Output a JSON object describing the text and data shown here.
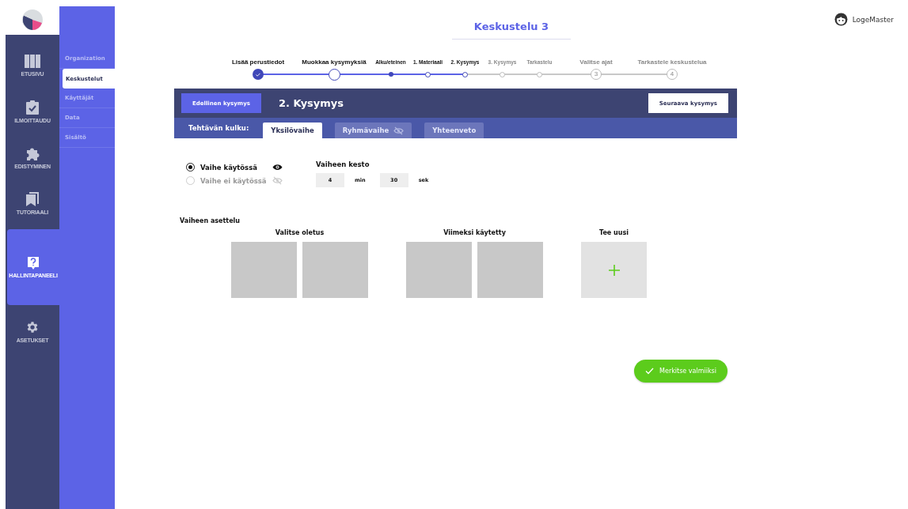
{
  "rail": {
    "items": [
      {
        "label": "ETUSIVU",
        "selected": false
      },
      {
        "label": "ILMOITTAUDU",
        "selected": false
      },
      {
        "label": "EDISTYMINEN",
        "selected": false
      },
      {
        "label": "TUTORIAALI",
        "selected": false
      },
      {
        "label": "HALLINTAPANEELI",
        "selected": true
      },
      {
        "label": "ASETUKSET",
        "selected": false
      }
    ]
  },
  "sidebar": {
    "items": [
      {
        "label": "Organization",
        "selected": false
      },
      {
        "label": "Keskustelut",
        "selected": true
      },
      {
        "label": "Käyttäjät",
        "selected": false
      },
      {
        "label": "Data",
        "selected": false
      },
      {
        "label": "Sisältö",
        "selected": false
      }
    ]
  },
  "page_title": "Keskustelu 3",
  "user": {
    "name": "LogeMaster"
  },
  "stepper": [
    {
      "label": "Lisää perustiedot",
      "kind": "major",
      "reached": true,
      "done": true
    },
    {
      "label": "Muokkaa kysymyksiä",
      "kind": "major",
      "reached": true,
      "done": false
    },
    {
      "label": "Alku/eteinen",
      "kind": "minor",
      "reached": true,
      "done": true
    },
    {
      "label": "1. Materiaali",
      "kind": "minor",
      "reached": true,
      "done": false
    },
    {
      "label": "2. Kysymys",
      "kind": "minor",
      "reached": true,
      "done": false
    },
    {
      "label": "3. Kysymys",
      "kind": "minor",
      "reached": false,
      "done": false
    },
    {
      "label": "Tarkastelu",
      "kind": "minor",
      "reached": false,
      "done": false
    },
    {
      "label": "Valitse ajat",
      "kind": "major",
      "reached": false,
      "done": false,
      "number": "3"
    },
    {
      "label": "Tarkastele keskustelua",
      "kind": "major",
      "reached": false,
      "done": false,
      "number": "4"
    }
  ],
  "question_bar": {
    "prev_button": "Edellinen kysymys",
    "title": "2. Kysymys",
    "next_button": "Seuraava kysymys"
  },
  "flow": {
    "label": "Tehtävän kulku:",
    "tabs": [
      {
        "label": "Yksilövaihe",
        "selected": true,
        "hidden": false
      },
      {
        "label": "Ryhmävaihe",
        "selected": false,
        "hidden": true
      },
      {
        "label": "Yhteenveto",
        "selected": false,
        "hidden": false
      }
    ]
  },
  "phase_options": [
    {
      "label": "Vaihe käytössä",
      "selected": true,
      "visible": true
    },
    {
      "label": "Vaihe ei käytössä",
      "selected": false,
      "visible": false
    }
  ],
  "duration": {
    "title": "Vaiheen kesto",
    "minutes": "4",
    "minutes_unit": "min",
    "seconds": "30",
    "seconds_unit": "sek"
  },
  "layout": {
    "title": "Vaiheen asettelu",
    "groups": [
      {
        "title": "Valitse oletus",
        "kind": "tiles"
      },
      {
        "title": "Viimeksi käytetty",
        "kind": "tiles"
      },
      {
        "title": "Tee uusi",
        "kind": "new"
      }
    ]
  },
  "done_button": "Merkitse valmiiksi"
}
